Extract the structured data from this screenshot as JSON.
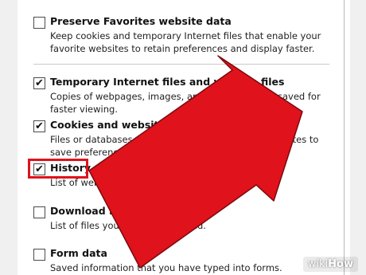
{
  "options": [
    {
      "title": "Preserve Favorites website data",
      "desc": "Keep cookies and temporary Internet files that enable your favorite websites to retain preferences and display faster.",
      "checked": false
    },
    {
      "title": "Temporary Internet files and website files",
      "desc": "Copies of webpages, images, and media that are saved for faster viewing.",
      "checked": true
    },
    {
      "title": "Cookies and website data",
      "desc": "Files or databases stored on your computer by websites to save preferences or improve website performance.",
      "checked": true
    },
    {
      "title": "History",
      "desc": "List of websites you have visited.",
      "checked": true
    },
    {
      "title": "Download History",
      "desc": "List of files you have downloaded.",
      "checked": false
    },
    {
      "title": "Form data",
      "desc": "Saved information that you have typed into forms.",
      "checked": false
    }
  ],
  "check_glyph": "✔",
  "watermark": {
    "prefix": "wiki",
    "suffix": "How"
  },
  "colors": {
    "arrow": "#e0121b",
    "highlight": "#e0121b"
  }
}
